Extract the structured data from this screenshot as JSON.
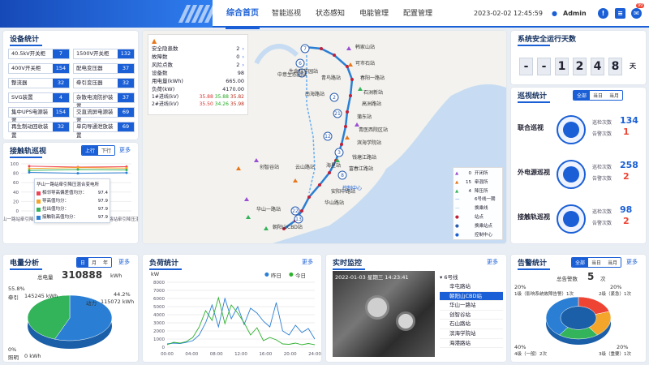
{
  "header": {
    "nav": [
      "综合首页",
      "智能巡视",
      "状态感知",
      "电能管理",
      "配置管理"
    ],
    "datetime": "2023-02-02 12:45:59",
    "user": "Admin",
    "badge_count": "99"
  },
  "device_stats": {
    "title": "设备统计",
    "items": [
      [
        "40.5kV开关柜",
        "7"
      ],
      [
        "1500V开关柜",
        "132"
      ],
      [
        "400V开关柜",
        "154"
      ],
      [
        "配电变压器",
        "37"
      ],
      [
        "整流器",
        "32"
      ],
      [
        "牵引变压器",
        "32"
      ],
      [
        "SVG装置",
        "4"
      ],
      [
        "杂散电流防护装置",
        "37"
      ],
      [
        "集中UPS电源装置",
        "154"
      ],
      [
        "交直流屏电源装置",
        "69"
      ],
      [
        "再生制动回收装置",
        "32"
      ],
      [
        "单向导通泄放装置",
        "69"
      ]
    ]
  },
  "catenary": {
    "title": "接触轨巡视",
    "tabs": [
      "上行",
      "下行"
    ],
    "more": "更多",
    "yticks": [
      "100",
      "80",
      "60",
      "40",
      "20",
      "0"
    ],
    "xlabels": [
      "华山一路站牵引降压混合变电所",
      "朝阳山CBD站降压变电所",
      "华山一路站牵引降压混合变电所"
    ],
    "tooltip": {
      "title": "华山一路站牵引降压混合变电所",
      "rows": [
        [
          "相邻导高偏差值均分：",
          "97.4"
        ],
        [
          "导高值均分：",
          "97.9"
        ],
        [
          "拉出值均分：",
          "97.9"
        ],
        [
          "接触轨高值均分：",
          "97.9"
        ]
      ]
    },
    "chart_data": {
      "type": "line",
      "x": [
        0,
        1,
        2
      ],
      "series": [
        {
          "values": [
            95,
            93,
            94
          ]
        },
        {
          "values": [
            90,
            92,
            91
          ]
        },
        {
          "values": [
            86,
            88,
            87
          ]
        },
        {
          "values": [
            82,
            80,
            81
          ]
        }
      ],
      "ylim": [
        0,
        100
      ]
    }
  },
  "map_info": {
    "rows": [
      [
        "安全隐患数",
        "2"
      ],
      [
        "故障数",
        "0"
      ],
      [
        "风险点数",
        "2"
      ],
      [
        "设备数",
        "98"
      ],
      [
        "用电量(kWh)",
        "665.00"
      ],
      [
        "负荷(kW)",
        "4170.00"
      ]
    ],
    "line1_label": "1#进线(kV)",
    "line1_vals": [
      "35.88",
      "35.88",
      "35.82"
    ],
    "line2_label": "2#进线(kV)",
    "line2_vals": [
      "35.50",
      "34.26",
      "35.98"
    ]
  },
  "map": {
    "stations": [
      "韩家山站",
      "可市石站",
      "春阳一路站",
      "石洲新站",
      "高洲路站",
      "蒲东站",
      "青医西院区站",
      "滨海学院站",
      "钱塘江路站",
      "富春江路站",
      "安阳中路站",
      "朝阳山CBD站",
      "华山一路站",
      "华山路站",
      "创智谷站",
      "生命科学园站",
      "中意生态园站",
      "青鸟路站",
      "南海路站",
      "海星站",
      "云山路站"
    ],
    "marks": [
      "7",
      "6",
      "4",
      "2",
      "21",
      "12",
      "3",
      "8",
      "22",
      "13"
    ],
    "control": "控制中心",
    "legend": [
      [
        "0",
        "开闭所"
      ],
      [
        "15",
        "牵混所"
      ],
      [
        "4",
        "降压所"
      ],
      [
        "",
        "6号线一期"
      ],
      [
        "",
        "换乘线"
      ],
      [
        "",
        "站点"
      ],
      [
        "",
        "换乘站点"
      ],
      [
        "",
        "控制中心"
      ]
    ]
  },
  "safety_days": {
    "title": "系统安全运行天数",
    "digits": [
      "-",
      "-",
      "1",
      "2",
      "4",
      "8"
    ],
    "unit": "天"
  },
  "inspection": {
    "title": "巡视统计",
    "tabs": [
      "全部",
      "当日",
      "当月"
    ],
    "items": [
      {
        "name": "联合巡视",
        "count": "134",
        "alarm": "1"
      },
      {
        "name": "外电源巡视",
        "count": "258",
        "alarm": "2"
      },
      {
        "name": "接触轨巡视",
        "count": "98",
        "alarm": "2"
      }
    ],
    "count_label": "巡检次数",
    "alarm_label": "告警次数"
  },
  "energy": {
    "title": "电量分析",
    "tabs": [
      "日",
      "月",
      "年"
    ],
    "more": "更多",
    "total_label": "总电量",
    "total": "310888",
    "unit": "kWh",
    "slices": [
      {
        "label": "牵引",
        "pct": "55.8%",
        "val": "145245 kWh"
      },
      {
        "label": "动力",
        "pct": "44.2%",
        "val": "115072 kWh"
      },
      {
        "label": "照明",
        "pct": "0%",
        "val": "0 kWh"
      }
    ],
    "chart_data": {
      "type": "pie",
      "categories": [
        "牵引",
        "动力",
        "照明"
      ],
      "values": [
        55.8,
        44.2,
        0
      ]
    }
  },
  "load": {
    "title": "负荷统计",
    "more": "更多",
    "unit": "kW",
    "legend": [
      "昨日",
      "今日"
    ],
    "yticks": [
      "8000",
      "7000",
      "6000",
      "5000",
      "4000",
      "3000",
      "2000",
      "1000",
      "0"
    ],
    "xticks": [
      "00:00",
      "04:00",
      "08:00",
      "12:00",
      "16:00",
      "20:00",
      "24:00"
    ],
    "chart_data": {
      "type": "line",
      "series": [
        {
          "name": "昨日",
          "values": [
            400,
            500,
            450,
            600,
            800,
            1500,
            3000,
            5200,
            2500,
            6000,
            3500,
            5000,
            2800,
            4800,
            4200,
            3200,
            2500,
            5500,
            2000,
            1500,
            2700,
            1800,
            2300,
            1000
          ]
        },
        {
          "name": "今日",
          "values": [
            300,
            600,
            500,
            700,
            1200,
            2500,
            4500,
            3300,
            6100,
            2900,
            5200,
            4200,
            3000,
            1500,
            2400,
            800,
            1200,
            900,
            400,
            350,
            500,
            300,
            450,
            300
          ]
        }
      ],
      "ylim": [
        0,
        8000
      ]
    }
  },
  "monitor": {
    "title": "实时监控",
    "more": "更多",
    "stamp": "2022-01-03 星期三 14:23:41",
    "line": "6号线",
    "cams": [
      "辛屯路站",
      "朝阳山CBD站",
      "华山一路站",
      "创智谷站",
      "石山路站",
      "滨海学院站",
      "海港路站"
    ]
  },
  "alarm": {
    "title": "告警统计",
    "tabs": [
      "全部",
      "当日",
      "当月"
    ],
    "more": "更多",
    "total_label": "总告警数",
    "total": "5",
    "unit": "次",
    "items": [
      {
        "pct": "20%",
        "label": "1级（影响系统故障告警）1次"
      },
      {
        "pct": "20%",
        "label": "2级（紧急）1次"
      },
      {
        "pct": "40%",
        "label": "4级（一般）2次"
      },
      {
        "pct": "20%",
        "label": "3级（重要）1次"
      }
    ],
    "chart_data": {
      "type": "pie",
      "categories": [
        "1级",
        "2级",
        "3级",
        "4级"
      ],
      "values": [
        20,
        20,
        20,
        40
      ]
    }
  }
}
